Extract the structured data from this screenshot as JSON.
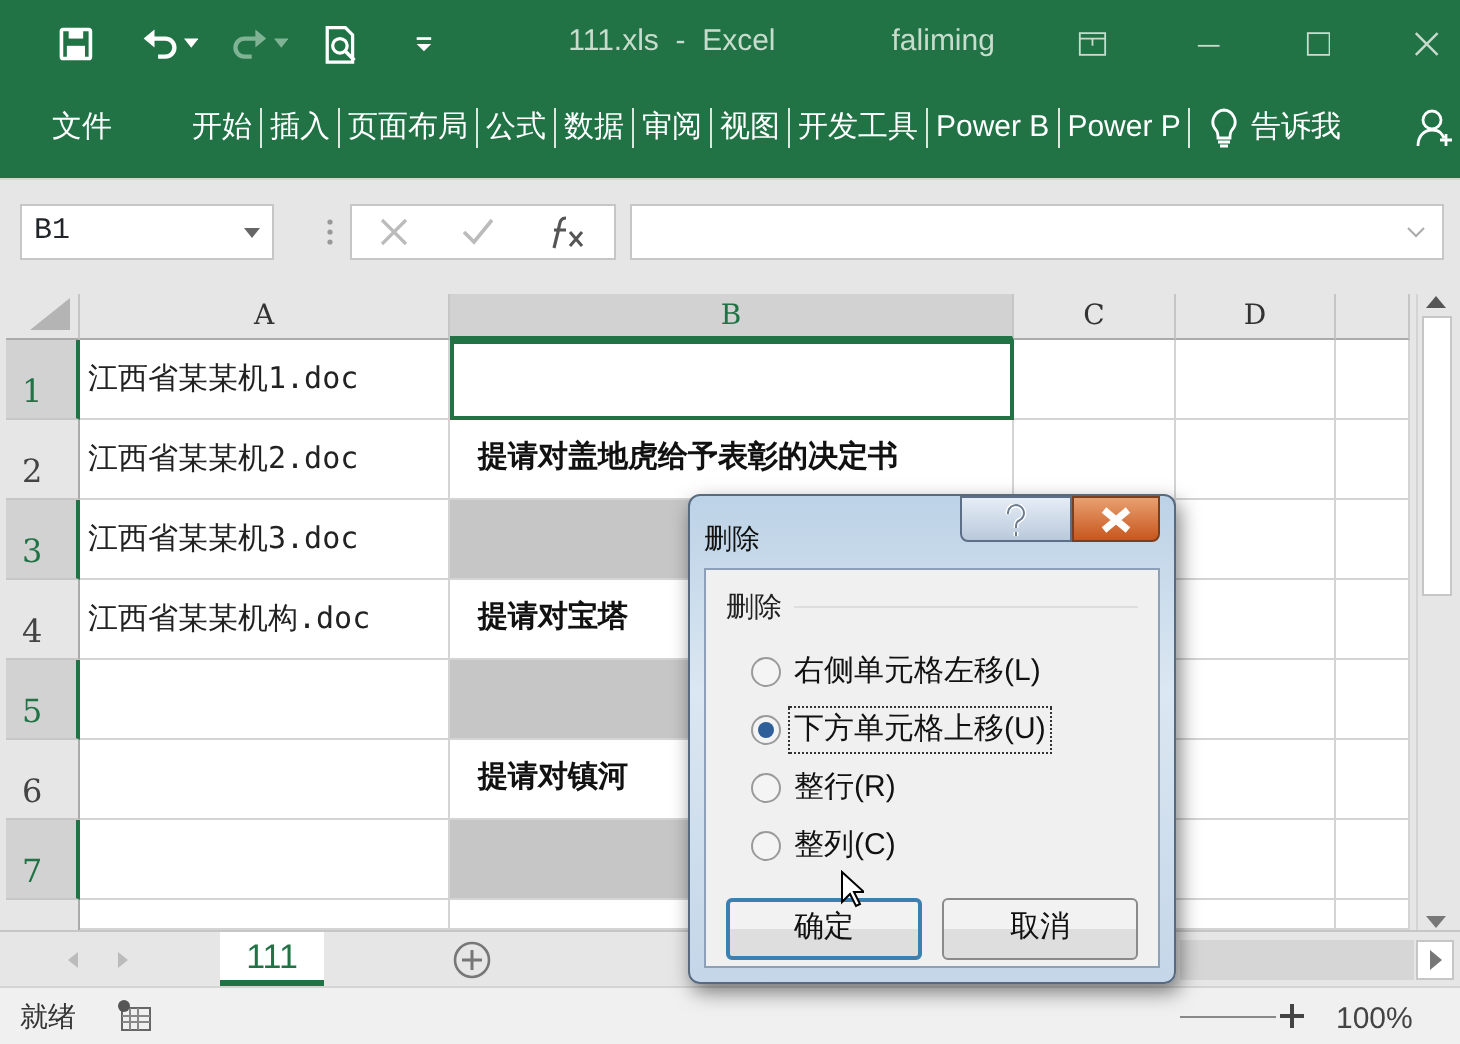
{
  "quick_access": [
    {
      "kind": "save",
      "disabled": false,
      "dropdown": false
    },
    {
      "kind": "undo",
      "disabled": false,
      "dropdown": true
    },
    {
      "kind": "redo",
      "disabled": true,
      "dropdown": true
    },
    {
      "kind": "print_preview",
      "disabled": false,
      "dropdown": false
    },
    {
      "kind": "customize",
      "disabled": false,
      "dropdown": false
    }
  ],
  "window": {
    "title": "111.xls  -  Excel",
    "user": "faliming"
  },
  "ribbon_tabs": [
    {
      "label": "文件"
    },
    {
      "label": "开始"
    },
    {
      "label": "插入"
    },
    {
      "label": "页面布局"
    },
    {
      "label": "公式"
    },
    {
      "label": "数据"
    },
    {
      "label": "审阅"
    },
    {
      "label": "视图"
    },
    {
      "label": "开发工具"
    },
    {
      "label": "Power B"
    },
    {
      "label": "Power P"
    }
  ],
  "tell_me": "告诉我",
  "name_box": "B1",
  "columns": [
    {
      "label": "A",
      "selected": false
    },
    {
      "label": "B",
      "selected": true
    },
    {
      "label": "C",
      "selected": false
    },
    {
      "label": "D",
      "selected": false
    }
  ],
  "rows": [
    {
      "number": "1",
      "selected": true,
      "active": true,
      "a": "江西省某某机1.doc"
    },
    {
      "number": "2",
      "selected": false,
      "active": false,
      "a": "江西省某某机2.doc",
      "b": "提请对盖地虎给予表彰的决定书"
    },
    {
      "number": "3",
      "selected": true,
      "active": false,
      "a": "江西省某某机3.doc"
    },
    {
      "number": "4",
      "selected": false,
      "active": false,
      "a": "江西省某某机构.doc",
      "b": "提请对宝塔"
    },
    {
      "number": "5",
      "selected": true,
      "active": false
    },
    {
      "number": "6",
      "selected": false,
      "active": false,
      "b": "提请对镇河"
    },
    {
      "number": "7",
      "selected": true,
      "active": false
    }
  ],
  "sheet_tabs": [
    {
      "label": "111",
      "selected": true
    }
  ],
  "status": "就绪",
  "zoom": "100%",
  "dialog": {
    "title": "删除",
    "group": "删除",
    "options": [
      {
        "label": "右侧单元格左移(L)",
        "selected": false,
        "focused": false
      },
      {
        "label": "下方单元格上移(U)",
        "selected": true,
        "focused": true
      },
      {
        "label": "整行(R)",
        "selected": false,
        "focused": false
      },
      {
        "label": "整列(C)",
        "selected": false,
        "focused": false
      }
    ],
    "buttons": [
      {
        "label": "确定",
        "default": true
      },
      {
        "label": "取消",
        "default": false
      }
    ]
  }
}
